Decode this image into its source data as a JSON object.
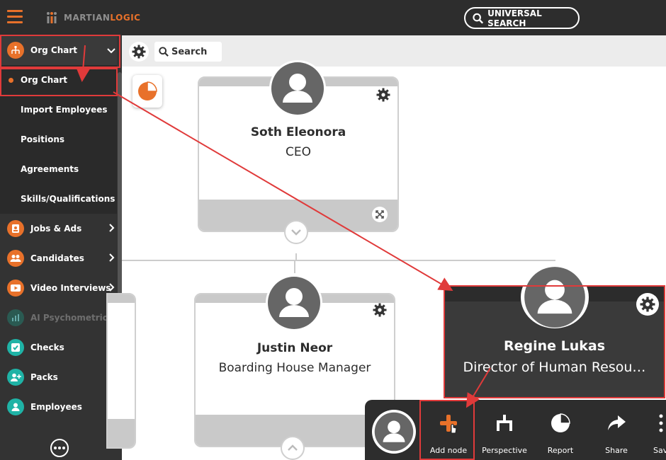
{
  "header": {
    "menu_icon": "hamburger-icon",
    "logo_part1": "MARTIAN",
    "logo_part2": "LOGIC",
    "universal_search_label": "UNIVERSAL SEARCH"
  },
  "sidebar": {
    "org_chart_label": "Org Chart",
    "sub_items": [
      "Org Chart",
      "Import Employees",
      "Positions",
      "Agreements",
      "Skills/Qualifications"
    ],
    "items": [
      {
        "label": "Jobs & Ads",
        "icon": "id-badge-icon",
        "color": "#e8712a",
        "disabled": false
      },
      {
        "label": "Candidates",
        "icon": "users-icon",
        "color": "#e8712a",
        "disabled": false
      },
      {
        "label": "Video Interviews",
        "icon": "play-icon",
        "color": "#e8712a",
        "disabled": false
      },
      {
        "label": "AI Psychometrics",
        "icon": "chart-icon",
        "color": "#2a7f6f",
        "disabled": true
      },
      {
        "label": "Checks",
        "icon": "check-icon",
        "color": "#1fb3a6",
        "disabled": false
      },
      {
        "label": "Packs",
        "icon": "user-plus-icon",
        "color": "#1fb3a6",
        "disabled": false
      },
      {
        "label": "Employees",
        "icon": "user-icon",
        "color": "#1fb3a6",
        "disabled": false
      }
    ]
  },
  "toolbar": {
    "search_label": "Search"
  },
  "org": {
    "ceo": {
      "name": "Soth Eleonora",
      "title": "CEO"
    },
    "manager": {
      "name": "Justin Neor",
      "title": "Boarding House Manager"
    },
    "selected": {
      "name": "Regine Lukas",
      "title": "Director of Human Resou…"
    }
  },
  "actions": [
    "Add node",
    "Perspective",
    "Report",
    "Share",
    "Sav"
  ],
  "colors": {
    "accent": "#e8712a",
    "highlight": "#e03a3a",
    "dark": "#2d2d2d"
  }
}
